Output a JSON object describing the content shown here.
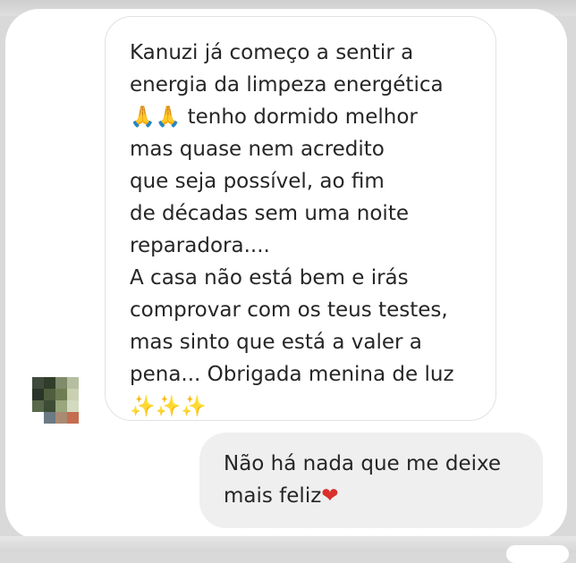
{
  "conversation": {
    "received_message": {
      "lines": [
        "Kanuzi já começo a sentir a",
        "energia da limpeza energética",
        "tenho dormido melhor",
        "mas quase nem acredito",
        "que seja possível, ao fim",
        "de décadas sem uma noite",
        "reparadora....",
        "A casa não está bem e irás",
        "comprovar com os teus testes,",
        "mas sinto que está a valer a",
        "pena... Obrigada menina de luz"
      ],
      "emoji_pray": "🙏🙏",
      "emoji_sparkles": "✨✨✨"
    },
    "sent_message": {
      "lines": [
        "Não há nada que me deixe",
        "mais feliz"
      ],
      "emoji_heart": "❤"
    },
    "sender_avatar": {
      "type": "pixelated-avatar",
      "colors": [
        "#3f4a3c",
        "#2f3d2a",
        "#7f8b6a",
        "#b5bfa0",
        "#2b3428",
        "#4f5e3e",
        "#6e7d52",
        "#c9d0b2",
        "#58684a",
        "#3d4c35",
        "#9aa67b",
        "#d3dac0",
        "#ffffff",
        "#6b7a84",
        "#a98a73",
        "#c46d50"
      ]
    }
  },
  "icons": {
    "avatar": "pixelated-avatar",
    "pray": "folded-hands-emoji",
    "sparkles": "sparkles-emoji",
    "heart": "red-heart-emoji"
  }
}
